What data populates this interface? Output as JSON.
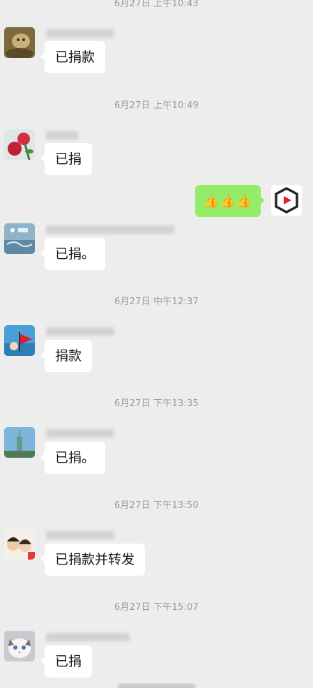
{
  "chat": {
    "messages": [
      {
        "timestamp": "6月27日 上午10:43",
        "text": "已捐款",
        "side": "left",
        "avatar": "avatar-dog"
      },
      {
        "timestamp": "6月27日 上午10:49",
        "text": "已捐",
        "side": "left",
        "avatar": "avatar-flowers"
      },
      {
        "timestamp": "",
        "text": "👍👍👍",
        "side": "right",
        "avatar": "avatar-play-logo"
      },
      {
        "timestamp": "",
        "text": "已捐。",
        "side": "left",
        "avatar": "avatar-sea-text"
      },
      {
        "timestamp": "6月27日 中午12:37",
        "text": "捐款",
        "side": "left",
        "avatar": "avatar-sea-flag"
      },
      {
        "timestamp": "6月27日 下午13:35",
        "text": "已捐。",
        "side": "left",
        "avatar": "avatar-statue"
      },
      {
        "timestamp": "6月27日 下午13:50",
        "text": "已捐款并转发",
        "side": "left",
        "avatar": "avatar-couple"
      },
      {
        "timestamp": "6月27日 下午15:07",
        "text": "已捐",
        "side": "left",
        "avatar": "avatar-cat"
      }
    ]
  },
  "colors": {
    "background": "#ededed",
    "bubble_incoming": "#ffffff",
    "bubble_outgoing": "#95ec69",
    "timestamp_text": "#9a9a9a"
  }
}
